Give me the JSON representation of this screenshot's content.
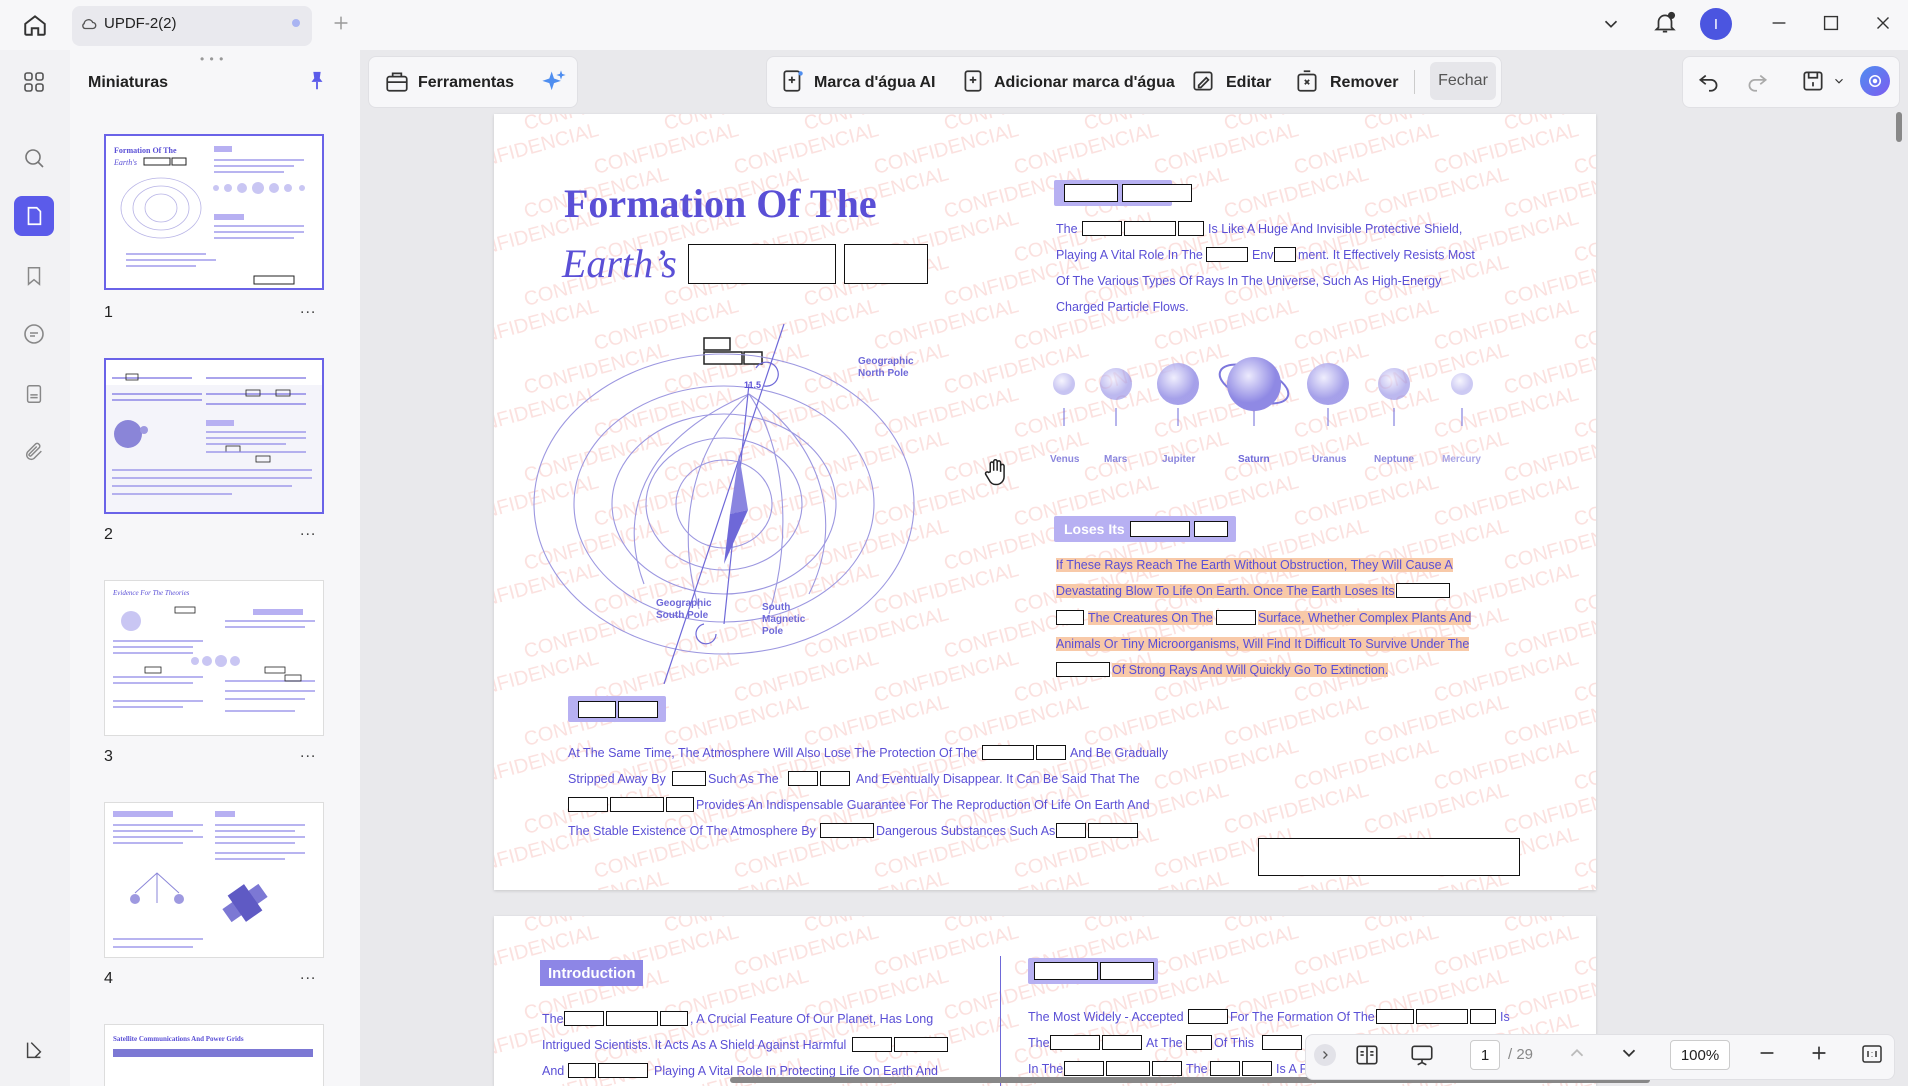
{
  "window": {
    "tab_title": "UPDF-2(2)",
    "user_initial": "I"
  },
  "panel": {
    "title": "Miniaturas",
    "pages": [
      {
        "num": "1",
        "more": "..."
      },
      {
        "num": "2",
        "more": "..."
      },
      {
        "num": "3",
        "more": "..."
      },
      {
        "num": "4",
        "more": "..."
      }
    ]
  },
  "toolbar": {
    "tools_label": "Ferramentas",
    "ai_watermark": "Marca d'água AI",
    "add_watermark": "Adicionar marca d'água",
    "edit": "Editar",
    "remove": "Remover",
    "close": "Fechar"
  },
  "watermark_text": "CONFIDENCIAL",
  "doc": {
    "title_line1": "Formation Of The",
    "title_line2": "Earth’s",
    "diagram": {
      "north_pole": "Geographic\nNorth Pole",
      "angle": "11.5",
      "south_pole": "Geographic\nSouth Pole",
      "south_magnetic": "South\nMagnetic\nPole"
    },
    "planets": [
      "Venus",
      "Mars",
      "Jupiter",
      "Saturn",
      "Uranus",
      "Neptune",
      "Mercury"
    ],
    "right_para": [
      "The",
      "Is Like A Huge And Invisible Protective Shield,",
      "Playing A Vital Role In The",
      "Env",
      "ment. It Effectively Resists Most",
      "Of The Various Types Of Rays In The Universe, Such As High-Energy",
      "Charged Particle Flows."
    ],
    "loses_heading": "Loses Its",
    "loses_para": [
      "If These Rays Reach The Earth Without Obstruction, They Will Cause A",
      "Devastating Blow To Life On Earth. Once The Earth Loses Its",
      "The Creatures On The",
      "Surface, Whether Complex Plants And",
      "Animals Or Tiny Microorganisms, Will Find It Difficult To Survive Under The",
      "Of Strong Rays And Will Quickly Go To Extinction."
    ],
    "bottom_para": [
      "At The Same Time, The Atmosphere Will Also Lose The Protection Of The",
      "And Be Gradually",
      "Stripped Away By",
      "Such As The",
      "And Eventually Disappear. It Can Be Said That The",
      "Provides An Indispensable Guarantee For The Reproduction Of Life On Earth And",
      "The Stable Existence Of The Atmosphere By",
      "Dangerous Substances Such As"
    ],
    "page2": {
      "intro_heading": "Introduction",
      "left": [
        "The",
        ", A Crucial Feature Of Our Planet, Has Long",
        "Intrigued Scientists. It Acts As A Shield Against Harmful",
        "And",
        "Playing A Vital Role In Protecting Life On Earth And"
      ],
      "right": [
        "The Most Widely - Accepted",
        "For The Formation Of The",
        "Is",
        "The",
        "At The",
        "Of This",
        "In The",
        "The",
        "Is A Flu"
      ]
    }
  },
  "thumbs": {
    "t1_title": "Formation Of The",
    "t1_sub": "Earth's",
    "t3_title": "Evidence For The Theories",
    "t5_title": "Satellite Communications And Power Grids"
  },
  "bottombar": {
    "page": "1",
    "total": "/ 29",
    "zoom": "100%"
  }
}
